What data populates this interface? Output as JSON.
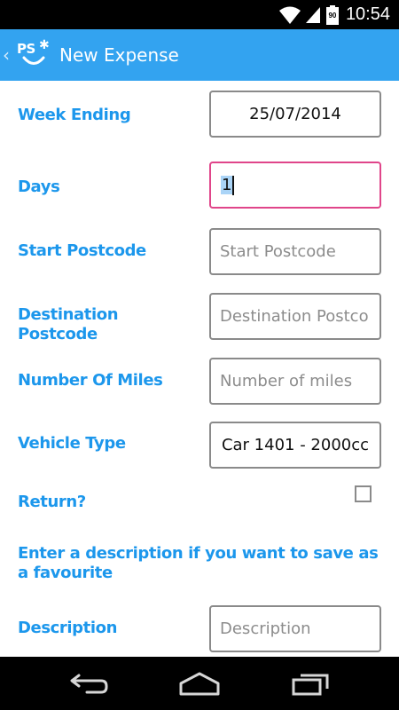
{
  "status_bar": {
    "time": "10:54",
    "battery_level": "90"
  },
  "app_bar": {
    "logo_text": "PS",
    "title": "New Expense"
  },
  "form": {
    "week_ending": {
      "label": "Week Ending",
      "value": "25/07/2014"
    },
    "days": {
      "label": "Days",
      "value": "1"
    },
    "start_postcode": {
      "label": "Start Postcode",
      "placeholder": "Start Postcode"
    },
    "destination_postcode": {
      "label_line1": "Destination",
      "label_line2": "Postcode",
      "placeholder": "Destination Postco"
    },
    "number_of_miles": {
      "label": "Number Of Miles",
      "placeholder": "Number of miles"
    },
    "vehicle_type": {
      "label": "Vehicle Type",
      "value": "Car 1401 - 2000cc"
    },
    "return": {
      "label": "Return?",
      "checked": false
    },
    "favourite_hint": {
      "line1": "Enter a description if you want to save as",
      "line2": "a favourite"
    },
    "description": {
      "label": "Description",
      "placeholder": "Description"
    }
  },
  "colors": {
    "app_bar": "#33a3f0",
    "label": "#1c97ec",
    "focus_border": "#e0458a",
    "field_border": "#8a8a8a",
    "placeholder": "#8c8c8c",
    "selection": "#aad4f7"
  },
  "icons": [
    "wifi-icon",
    "signal-icon",
    "battery-icon",
    "back-icon",
    "home-icon",
    "recent-apps-icon"
  ]
}
